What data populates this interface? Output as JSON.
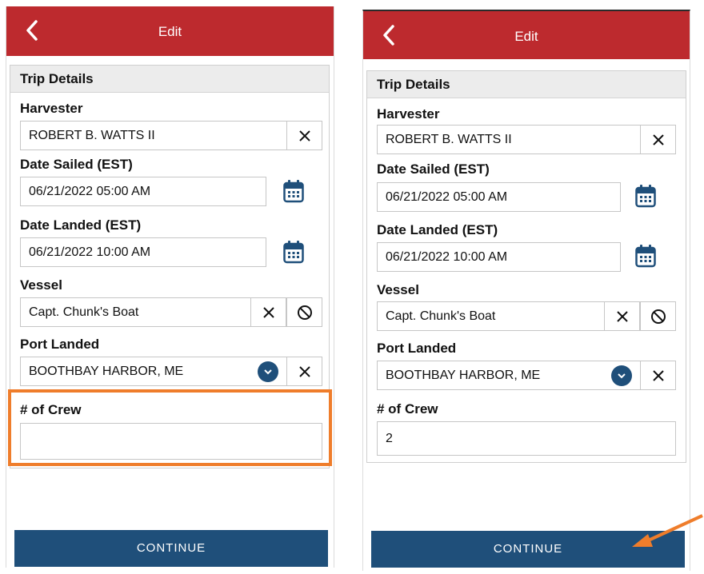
{
  "colors": {
    "header": "#bd2a2e",
    "accent": "#1f4f7a",
    "highlight": "#ef7d2b"
  },
  "left": {
    "header": {
      "title": "Edit",
      "back_icon": "chevron-left-icon"
    },
    "section_title": "Trip Details",
    "harvester": {
      "label": "Harvester",
      "value": "ROBERT B. WATTS II"
    },
    "date_sailed": {
      "label": "Date Sailed (EST)",
      "value": "06/21/2022 05:00 AM"
    },
    "date_landed": {
      "label": "Date Landed (EST)",
      "value": "06/21/2022 10:00 AM"
    },
    "vessel": {
      "label": "Vessel",
      "value": "Capt. Chunk's Boat"
    },
    "port_landed": {
      "label": "Port Landed",
      "value": "BOOTHBAY HARBOR, ME"
    },
    "crew": {
      "label": "# of Crew",
      "value": ""
    },
    "continue_label": "CONTINUE"
  },
  "right": {
    "header": {
      "title": "Edit",
      "back_icon": "chevron-left-icon"
    },
    "section_title": "Trip Details",
    "harvester": {
      "label": "Harvester",
      "value": "ROBERT B. WATTS II"
    },
    "date_sailed": {
      "label": "Date Sailed (EST)",
      "value": "06/21/2022 05:00 AM"
    },
    "date_landed": {
      "label": "Date Landed (EST)",
      "value": "06/21/2022 10:00 AM"
    },
    "vessel": {
      "label": "Vessel",
      "value": "Capt. Chunk's Boat"
    },
    "port_landed": {
      "label": "Port Landed",
      "value": "BOOTHBAY HARBOR, ME"
    },
    "crew": {
      "label": "# of Crew",
      "value": "2"
    },
    "continue_label": "CONTINUE"
  }
}
